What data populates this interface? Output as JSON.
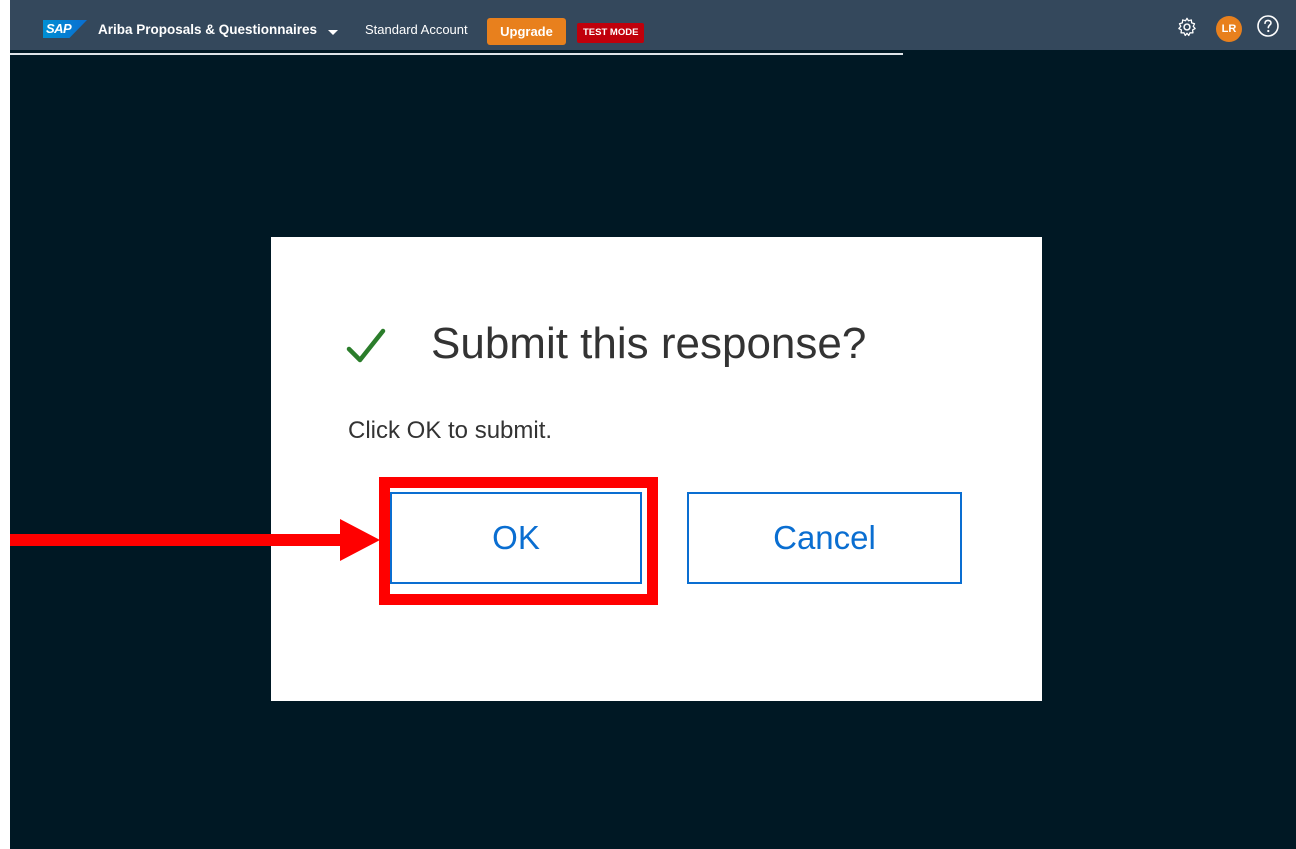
{
  "header": {
    "logo_text": "SAP",
    "product_title": "Ariba Proposals & Questionnaires",
    "account_type": "Standard Account",
    "upgrade_label": "Upgrade",
    "mode_badge": "TEST MODE",
    "user_initials": "LR"
  },
  "dialog": {
    "title": "Submit this response?",
    "message": "Click OK to submit.",
    "ok_label": "OK",
    "cancel_label": "Cancel"
  },
  "annotation": {
    "highlight_color": "#ff0000",
    "target": "OK button"
  },
  "colors": {
    "topbar": "#34485c",
    "overlay": "#001824",
    "accent": "#0a6ed1",
    "upgrade": "#e8801d",
    "test_badge": "#c0000b",
    "check": "#2b7d2b"
  }
}
